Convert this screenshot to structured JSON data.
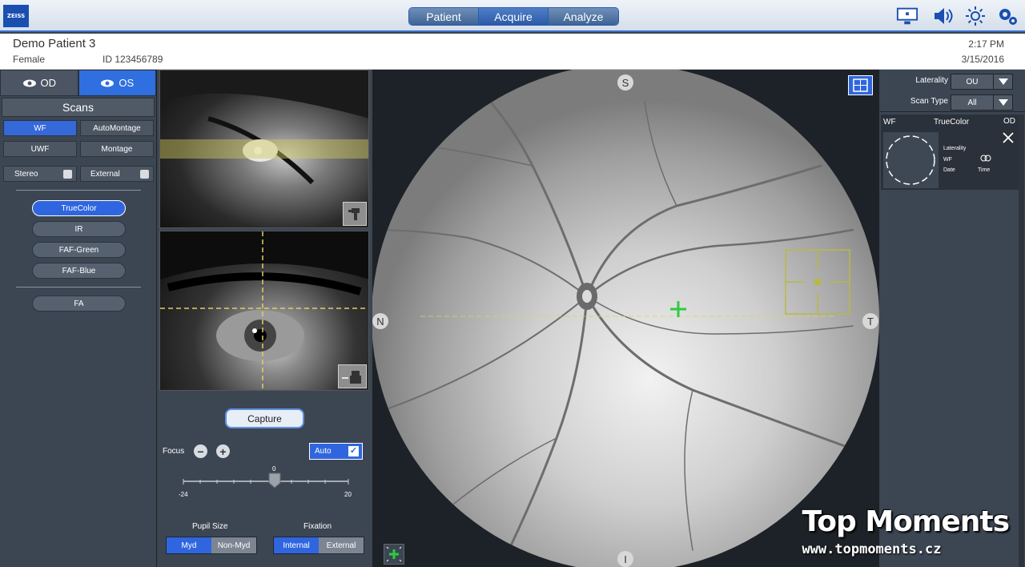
{
  "app": {
    "logo": "ZEISS"
  },
  "nav": {
    "tabs": [
      {
        "label": "Patient"
      },
      {
        "label": "Acquire"
      },
      {
        "label": "Analyze"
      }
    ]
  },
  "topbar_icons": [
    "monitor-icon",
    "speaker-icon",
    "brightness-icon",
    "settings-icon"
  ],
  "patient": {
    "name": "Demo Patient 3",
    "sex": "Female",
    "id": "ID 123456789",
    "time": "2:17 PM",
    "date": "3/15/2016"
  },
  "left": {
    "eye_tabs": [
      {
        "label": "OD"
      },
      {
        "label": "OS"
      }
    ],
    "scans_title": "Scans",
    "scan_buttons": [
      {
        "label": "WF"
      },
      {
        "label": "AutoMontage"
      },
      {
        "label": "UWF"
      },
      {
        "label": "Montage"
      },
      {
        "label": "Stereo"
      },
      {
        "label": "External"
      }
    ],
    "modes": [
      {
        "label": "TrueColor"
      },
      {
        "label": "IR"
      },
      {
        "label": "FAF-Green"
      },
      {
        "label": "FAF-Blue"
      },
      {
        "label": "FA"
      }
    ]
  },
  "controls": {
    "capture_label": "Capture",
    "focus_label": "Focus",
    "auto_label": "Auto",
    "auto_checked": true,
    "focus_value": 0,
    "focus_value_label": "0",
    "focus_min": "-24",
    "focus_max": "20",
    "pupil_label": "Pupil Size",
    "pupil_options": [
      {
        "label": "Myd"
      },
      {
        "label": "Non-Myd"
      }
    ],
    "fixation_label": "Fixation",
    "fixation_options": [
      {
        "label": "Internal"
      },
      {
        "label": "External"
      }
    ]
  },
  "viewer": {
    "compass": {
      "top": "S",
      "left": "N",
      "right": "T",
      "bottom": "I"
    }
  },
  "right": {
    "laterality_label": "Laterality",
    "laterality_value": "OU",
    "scantype_label": "Scan Type",
    "scantype_value": "All",
    "card": {
      "type": "WF",
      "mode": "TrueColor",
      "eye": "OD",
      "f_laterality": "Laterality",
      "f_wf": "WF",
      "f_date": "Date",
      "f_time": "Time"
    }
  },
  "watermark": {
    "title": "Top Moments",
    "url": "www.topmoments.cz"
  },
  "colors": {
    "accent": "#2f66df",
    "panel": "#3c4653",
    "fixation": "#2ecc40"
  }
}
